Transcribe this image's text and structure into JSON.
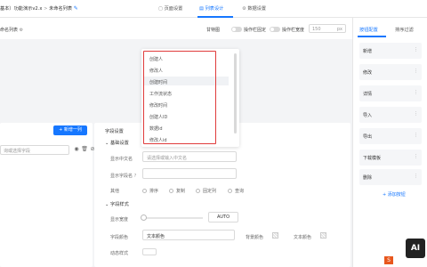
{
  "header": {
    "breadcrumb_prefix": "基本）功能演示v2.x",
    "breadcrumb_sep": ">",
    "breadcrumb_current": "未命名列表",
    "tabs": [
      "页面设置",
      "列表设计",
      "数据设置"
    ]
  },
  "toolbar": {
    "title": "命名列表",
    "sticky_label": "甘特图",
    "fixed_label": "操作栏固定",
    "width_label": "操作栏宽度",
    "width_value": "150",
    "width_unit": "px"
  },
  "right_panel": {
    "tabs": [
      "按钮配置",
      "排序过滤"
    ],
    "items": [
      "新增",
      "修改",
      "详情",
      "导入",
      "导出",
      "下载模板",
      "删除"
    ],
    "add_button": "+ 添加按钮"
  },
  "left_panel": {
    "batch_add": "批量添加",
    "new_column": "+ 新增一列",
    "search_placeholder": "询或选择字段"
  },
  "dropdown": {
    "items": [
      "创建人",
      "修改人",
      "创建时间",
      "工作流状态",
      "修改时间",
      "创建人ID",
      "数据id",
      "修改人id"
    ],
    "highlighted_index": 2
  },
  "field_settings": {
    "title": "字段设置",
    "basic_section": "基础设置",
    "display_cn_label": "显示中文名",
    "display_cn_placeholder": "请选择或输入中文名",
    "display_en_label": "显示字段名",
    "other_label": "其他",
    "other_options": [
      "排序",
      "复制",
      "固定列",
      "查询"
    ],
    "style_section": "字段样式",
    "display_width_label": "显示宽度",
    "width_value": "AUTO",
    "font_color_label": "字段颜色",
    "font_color_value": "文本颜色",
    "bg_color_label": "背景颜色",
    "text_color_label": "文本颜色",
    "dynamic_style_label": "动态样式"
  },
  "colors": {
    "accent": "#1677ff",
    "highlight": "#e03b3b"
  }
}
